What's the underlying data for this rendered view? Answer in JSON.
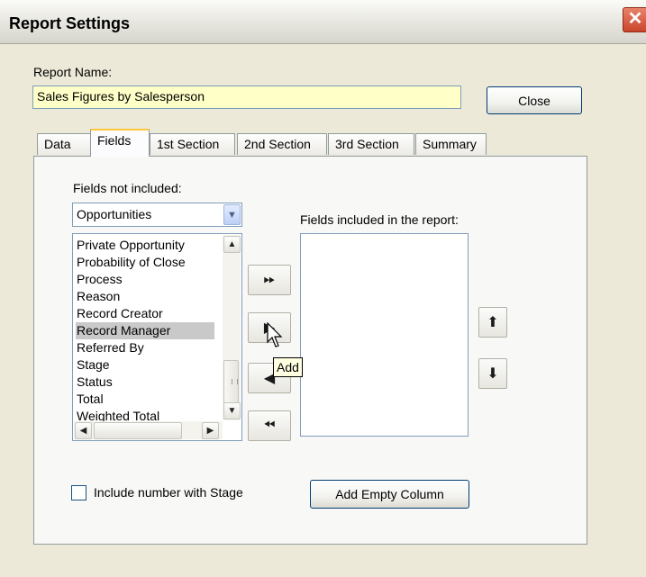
{
  "window": {
    "title": "Report Settings",
    "close_glyph": "✕"
  },
  "report_name": {
    "label": "Report Name:",
    "value": "Sales Figures by Salesperson"
  },
  "close_button": {
    "label": "Close"
  },
  "tabs": [
    {
      "label": "Data"
    },
    {
      "label": "Fields"
    },
    {
      "label": "1st Section"
    },
    {
      "label": "2nd Section"
    },
    {
      "label": "3rd Section"
    },
    {
      "label": "Summary"
    }
  ],
  "fields_not_included": {
    "label": "Fields not included:",
    "dropdown_value": "Opportunities",
    "items": [
      "Private Opportunity",
      "Probability of Close",
      "Process",
      "Reason",
      "Record Creator",
      "Record Manager",
      "Referred By",
      "Stage",
      "Status",
      "Total",
      "Weighted Total"
    ],
    "selected_item": "Record Manager"
  },
  "fields_included": {
    "label": "Fields included in the report:",
    "items": []
  },
  "tooltip": {
    "text": "Add"
  },
  "include_number_checkbox": {
    "label": "Include number with Stage",
    "checked": false
  },
  "add_empty_column_button": {
    "label": "Add Empty Column"
  },
  "icons": {
    "add_all": "double-right-arrow-icon",
    "add": "right-arrow-icon",
    "remove": "left-arrow-icon",
    "remove_all": "double-left-arrow-icon",
    "move_up": "up-arrow-icon",
    "move_down": "down-arrow-icon"
  }
}
